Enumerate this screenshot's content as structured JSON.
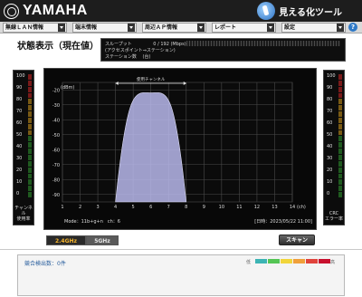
{
  "header": {
    "brand": "YAMAHA",
    "tool_name": "見える化ツール",
    "menus": [
      {
        "label": "無線ＬＡＮ情報"
      },
      {
        "label": "端末情報"
      },
      {
        "label": "周辺ＡＰ情報"
      },
      {
        "label": "レポート"
      },
      {
        "label": "設定"
      }
    ],
    "help_label": "?"
  },
  "page": {
    "title": "状態表示（現在値）"
  },
  "info_panel": {
    "throughput_label": "スループット",
    "throughput_value": "0 / 192 (Mbps)",
    "throughput_note": "(アクセスポイント⇒ステーション)",
    "station_label": "ステーション数",
    "station_value": "(台)"
  },
  "left_meter": {
    "ticks": [
      "100",
      "90",
      "80",
      "70",
      "60",
      "50",
      "40",
      "30",
      "20",
      "10",
      "0"
    ],
    "caption_line1": "チャンネル",
    "caption_line2": "使用率"
  },
  "right_meter": {
    "ticks": [
      "100",
      "90",
      "80",
      "70",
      "60",
      "50",
      "40",
      "30",
      "20",
      "10",
      "0"
    ],
    "caption_line1": "CRC",
    "caption_line2": "エラー率"
  },
  "chart_data": {
    "type": "area",
    "ylabel": "(dBm)",
    "xlabel": "(ch)",
    "y_ticks": [
      -20,
      -30,
      -40,
      -50,
      -60,
      -70,
      -80,
      -90
    ],
    "ylim": [
      -95,
      -15
    ],
    "x_categories": [
      "1",
      "2",
      "3",
      "4",
      "5",
      "6",
      "7",
      "8",
      "9",
      "10",
      "11",
      "12",
      "13",
      "14"
    ],
    "grid": true,
    "legend": "none",
    "series": [
      {
        "channels": [
          4,
          4.5,
          5,
          5.5,
          6,
          6.5,
          7,
          7.5,
          8
        ],
        "values": [
          -95,
          -60,
          -37,
          -25,
          -22,
          -25,
          -37,
          -60,
          -95
        ],
        "color": "#b9b9ec"
      }
    ],
    "annotation": {
      "label": "使用チャンネル",
      "from_channel": 4,
      "to_channel": 8
    },
    "mode_label": "Mode：11b+g+n　ch：6",
    "date_label": "[日時：2023/05/22 11:00]"
  },
  "controls": {
    "band_24": "2.4GHz",
    "band_5": "5GHz",
    "scan": "スキャン"
  },
  "bottom_panel": {
    "detected_count": "競合検出数：0件",
    "level_low": "低",
    "level_high": "高",
    "level_colors": [
      "#3cb4b4",
      "#55c555",
      "#f1d53a",
      "#f0a03a",
      "#e0433b",
      "#c8102e"
    ]
  }
}
